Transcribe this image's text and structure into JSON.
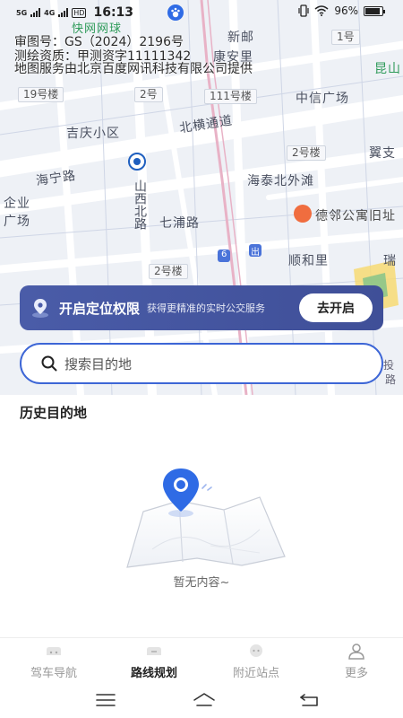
{
  "status_bar": {
    "signal_1": "5G",
    "signal_2": "4G",
    "hd": "HD",
    "time": "16:13",
    "battery": "96%",
    "battery_level": 0.96
  },
  "map": {
    "approval_lines": [
      "审图号：GS（2024）2196号",
      "测绘资质：甲测资字11111342",
      "地图服务由北京百度网讯科技有限公司提供"
    ],
    "labels": {
      "kuaiwang": "快网网球",
      "xinyou": "新邮",
      "kangan": "康安里",
      "yihao": "1号",
      "kunshan": "昆山",
      "jiuhao": "19号楼",
      "erhao": "2号",
      "yiyiyihao": "111号楼",
      "zhongxin": "中信广场",
      "jiqing": "吉庆小区",
      "beiheng": "北横通道",
      "erhaolou_r": "2号楼",
      "yizhi": "翼支",
      "haining": "海宁路",
      "haitai": "海泰北外滩",
      "qiye": "企业",
      "guangchang": "广场",
      "shanxibei": "山西北路",
      "qipu": "七浦路",
      "deling": "德邻公寓旧址",
      "shunhe": "顺和里",
      "erhaolou_b": "2号楼",
      "route_6": "6",
      "chu": "出",
      "rui": "瑞",
      "tou": "投",
      "lu": "路"
    }
  },
  "location_banner": {
    "title": "开启定位权限",
    "subtitle": "获得更精准的实时公交服务",
    "button": "去开启"
  },
  "search": {
    "placeholder": "搜索目的地"
  },
  "history": {
    "title": "历史目的地",
    "empty_text": "暂无内容~"
  },
  "tabs": [
    {
      "label": "驾车导航",
      "icon": "car-icon",
      "active": false
    },
    {
      "label": "路线规划",
      "icon": "route-icon",
      "active": true
    },
    {
      "label": "附近站点",
      "icon": "bus-stop-icon",
      "active": false
    },
    {
      "label": "更多",
      "icon": "user-icon",
      "active": false
    }
  ],
  "colors": {
    "accent": "#3d66d6",
    "banner": "#4556a3",
    "pin": "#2f6be5"
  }
}
